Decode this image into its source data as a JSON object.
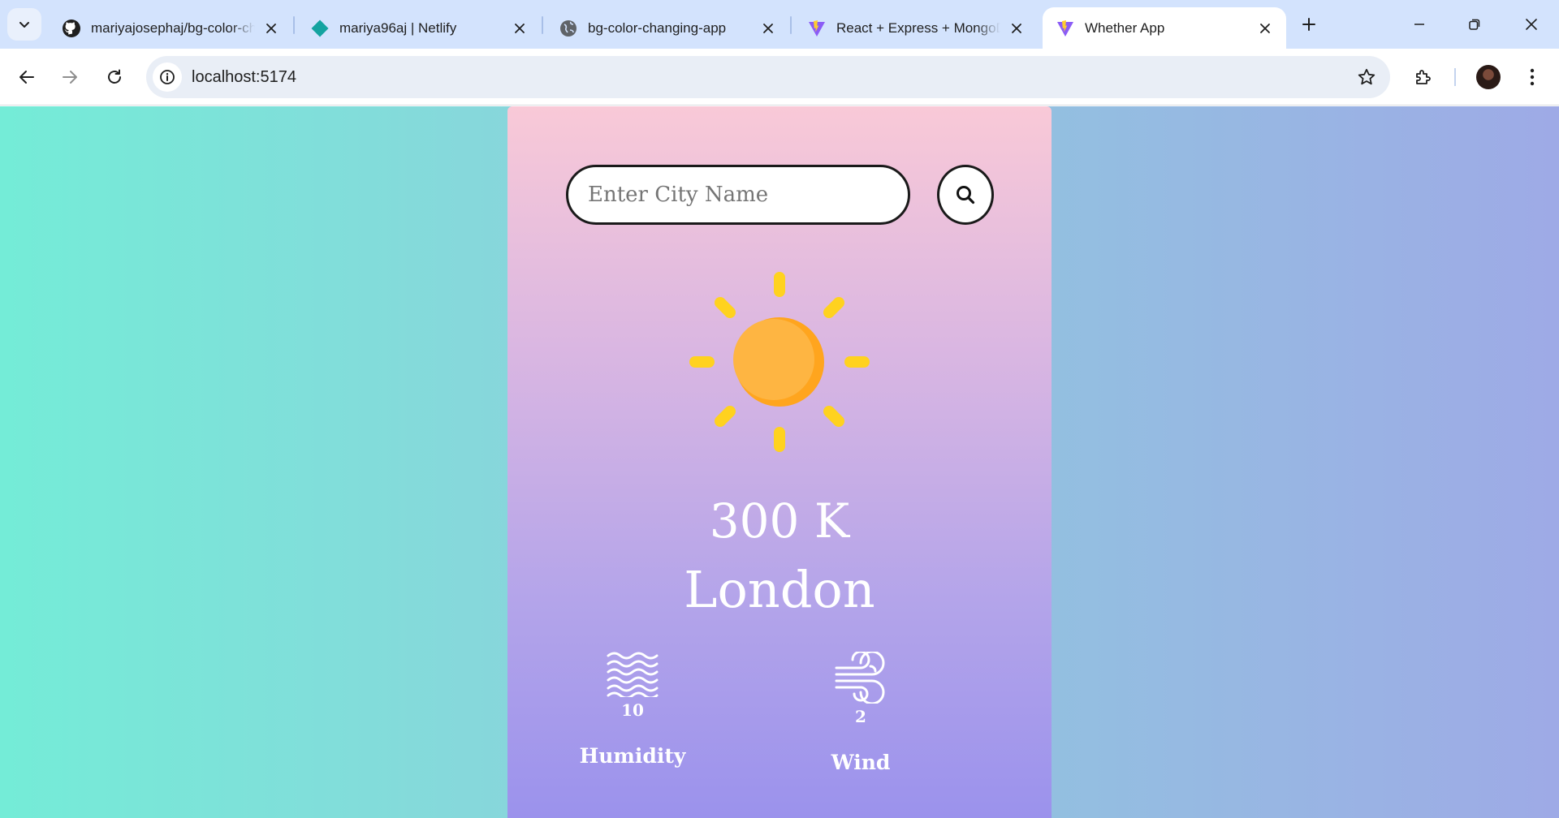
{
  "browser": {
    "tabs": [
      {
        "title": "mariyajosephaj/bg-color-changing-app",
        "icon": "github-icon"
      },
      {
        "title": "mariya96aj | Netlify",
        "icon": "netlify-icon"
      },
      {
        "title": "bg-color-changing-app",
        "icon": "globe-icon"
      },
      {
        "title": "React + Express + MongoDB",
        "icon": "vite-icon"
      },
      {
        "title": "Whether App",
        "icon": "vite-icon",
        "active": true
      }
    ],
    "address": "localhost:5174"
  },
  "app": {
    "search": {
      "placeholder": "Enter City Name",
      "value": ""
    },
    "weather_icon": "sun-icon",
    "temperature": "300 K",
    "city": "London",
    "humidity": {
      "value": "10",
      "label": "Humidity",
      "icon": "humidity-waves-icon"
    },
    "wind": {
      "value": "2",
      "label": "Wind",
      "icon": "wind-icon"
    }
  },
  "colors": {
    "page_bg_left": "#74ecd7",
    "page_bg_right": "#9eaae6",
    "card_top": "#f9c9d7",
    "card_bottom": "#9b92ec",
    "sun": "#feb03f",
    "sun_rays": "#ffd21f"
  }
}
